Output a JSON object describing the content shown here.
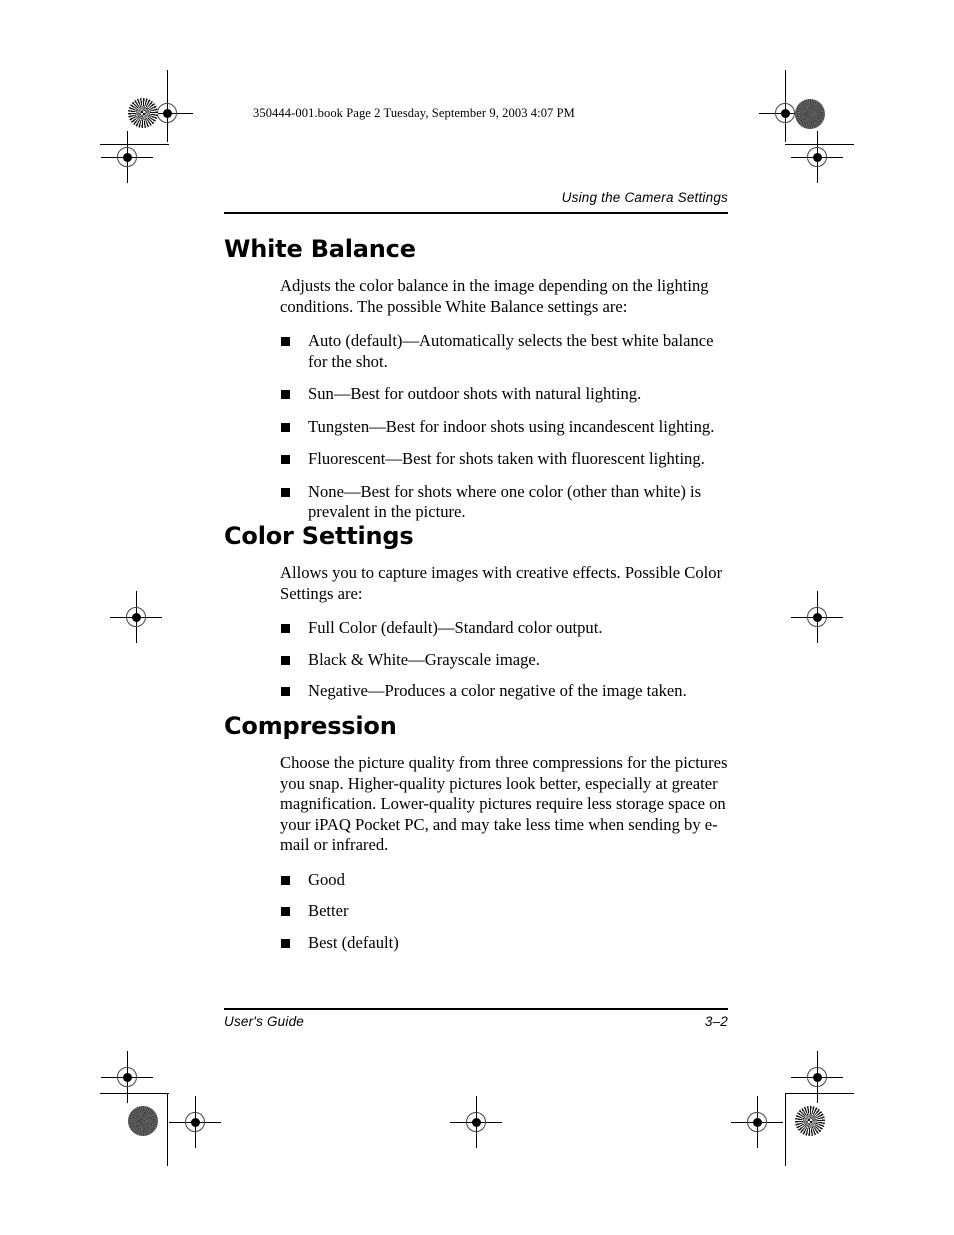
{
  "marks": {
    "book_line": "350444-001.book  Page 2  Tuesday, September 9, 2003  4:07 PM"
  },
  "header": {
    "running_head": "Using the Camera Settings"
  },
  "footer": {
    "guide_label": "User's Guide",
    "page_number": "3–2"
  },
  "sections": [
    {
      "heading": "White Balance",
      "paragraph": "Adjusts the color balance in the image depending on the lighting conditions. The possible White Balance settings are:",
      "bullets": [
        "Auto (default)—Automatically selects the best white balance for the shot.",
        "Sun—Best for outdoor shots with natural lighting.",
        "Tungsten—Best for indoor shots using incandescent lighting.",
        "Fluorescent—Best for shots taken with fluorescent lighting.",
        "None—Best for shots where one color (other than white) is prevalent in the picture."
      ]
    },
    {
      "heading": "Color Settings",
      "paragraph": "Allows you to capture images with creative effects. Possible Color Settings are:",
      "bullets": [
        "Full Color (default)—Standard color output.",
        "Black & White—Grayscale image.",
        "Negative—Produces a color negative of the image taken."
      ]
    },
    {
      "heading": "Compression",
      "paragraph": "Choose the picture quality from three compressions for the pictures you snap. Higher-quality pictures look better, especially at greater magnification. Lower-quality pictures require less storage space on your iPAQ Pocket PC, and may take less time when sending by e-mail or infrared.",
      "bullets": [
        "Good",
        "Better",
        "Best (default)"
      ]
    }
  ]
}
